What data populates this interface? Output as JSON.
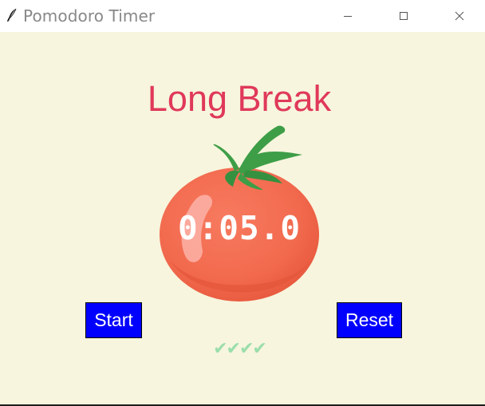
{
  "window": {
    "title": "Pomodoro Timer",
    "icon": "feather-icon",
    "controls": [
      "minimize-icon",
      "maximize-icon",
      "close-icon"
    ]
  },
  "timer": {
    "phase_label": "Long Break",
    "time_display": "0:05.0",
    "image": "tomato-icon"
  },
  "buttons": {
    "start_label": "Start",
    "reset_label": "Reset"
  },
  "progress": {
    "checkmarks": "✔✔✔✔",
    "completed_sessions": 4
  },
  "colors": {
    "background": "#f7f5dd",
    "phase_label": "#e0395a",
    "button_bg": "#0000ff",
    "button_text": "#ffffff",
    "checkmark": "#9bdeac",
    "timer_text": "#ffffff"
  }
}
